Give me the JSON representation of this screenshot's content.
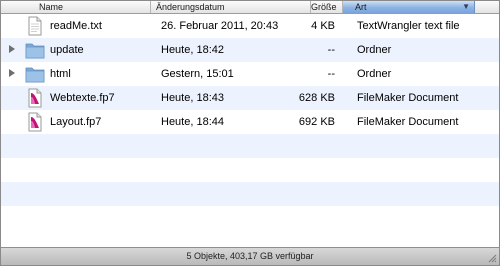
{
  "columns": {
    "name": "Name",
    "date": "Änderungsdatum",
    "size": "Größe",
    "kind": "Art",
    "sort_icon": "sort-descending-icon"
  },
  "files": [
    {
      "name": "readMe.txt",
      "date": "26. Februar 2011, 20:43",
      "size": "4 KB",
      "kind": "TextWrangler text file",
      "icon": "text-document-icon"
    },
    {
      "name": "update",
      "date": "Heute, 18:42",
      "size": "--",
      "kind": "Ordner",
      "icon": "folder-icon"
    },
    {
      "name": "html",
      "date": "Gestern, 15:01",
      "size": "--",
      "kind": "Ordner",
      "icon": "folder-icon"
    },
    {
      "name": "Webtexte.fp7",
      "date": "Heute, 18:43",
      "size": "628 KB",
      "kind": "FileMaker Document",
      "icon": "filemaker-document-icon"
    },
    {
      "name": "Layout.fp7",
      "date": "Heute, 18:44",
      "size": "692 KB",
      "kind": "FileMaker Document",
      "icon": "filemaker-document-icon"
    }
  ],
  "status": {
    "text": "5 Objekte, 403,17 GB verfügbar"
  },
  "colors": {
    "row_alt": "#edf3fe",
    "sorted_column": "#8db3e4",
    "folder": "#8fb7dd"
  }
}
